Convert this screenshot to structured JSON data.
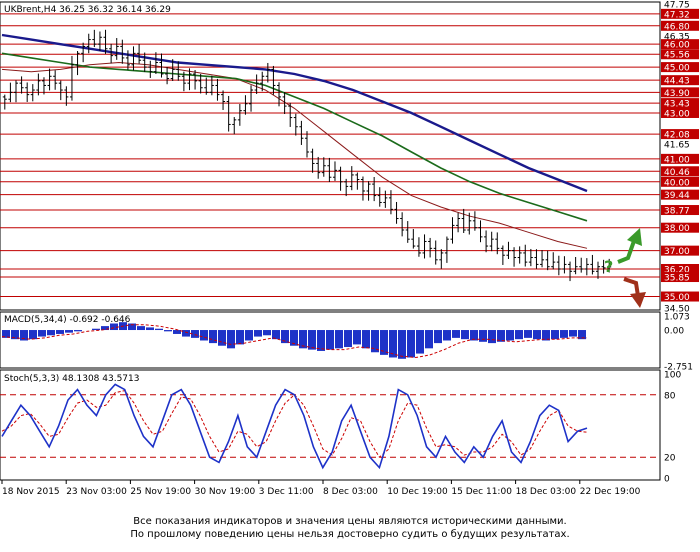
{
  "header": {
    "main": "UKBrent,H4  36.25 36.32 36.14 36.29",
    "macd": "MACD(5,34,4) -0.692 -0.646",
    "stoch": "Stoch(5,3,3) 48.1308 43.5713"
  },
  "disclaimer": {
    "line1": "Все показания индикаторов и значения цены являются историческими данными.",
    "line2": "По прошлому поведению цены нельзя достоверно судить о будущих результатах."
  },
  "colors": {
    "level_line": "#c00000",
    "price_tag_bg": "#c00000",
    "bars": "#000000",
    "ma_slow": "#1a1a8c",
    "ma_mid": "#1b6b1b",
    "ma_fast": "#8b1a1a",
    "macd_hist": "#1e32c8",
    "macd_signal": "#cc0000",
    "stoch_main": "#1e32c8",
    "stoch_signal": "#cc0000",
    "arrow_up": "#3a9a2a",
    "arrow_down": "#a0301a"
  },
  "icons": {
    "arrow_up": "green-up-arrow-icon",
    "arrow_down": "brown-down-arrow-icon",
    "question": "question-mark-icon"
  },
  "question_mark": "?",
  "chart_data": {
    "type": "candlestick",
    "timeframe": "H4",
    "symbol": "UKBrent",
    "ylim": [
      34.5,
      47.75
    ],
    "price_axis_ticks": [
      "47.75",
      "47.32",
      "46.80",
      "46.35",
      "46.00",
      "45.56",
      "45.00",
      "44.43",
      "43.90",
      "43.43",
      "43.00",
      "42.08",
      "41.65",
      "41.00",
      "40.46",
      "40.00",
      "39.44",
      "38.77",
      "38.00",
      "37.00",
      "36.20",
      "35.85",
      "35.00",
      "34.50"
    ],
    "highlighted_levels": [
      "47.32",
      "46.80",
      "46.00",
      "45.56",
      "45.00",
      "44.43",
      "43.90",
      "43.43",
      "43.00",
      "42.08",
      "41.00",
      "40.46",
      "40.00",
      "39.44",
      "38.77",
      "38.00",
      "37.00",
      "36.20",
      "35.85",
      "35.00"
    ],
    "x_tick_labels": [
      "18 Nov 2015",
      "23 Nov 03:00",
      "25 Nov 19:00",
      "30 Nov 19:00",
      "3 Dec 11:00",
      "8 Dec 03:00",
      "10 Dec 19:00",
      "15 Dec 11:00",
      "18 Dec 03:00",
      "22 Dec 19:00"
    ],
    "close_series": [
      43.6,
      43.9,
      44.3,
      44.1,
      43.8,
      44.0,
      44.4,
      44.2,
      44.6,
      44.3,
      44.0,
      43.7,
      45.1,
      45.6,
      45.9,
      46.2,
      46.0,
      46.3,
      45.8,
      45.5,
      45.9,
      45.4,
      45.1,
      45.6,
      45.3,
      45.0,
      44.8,
      45.2,
      44.7,
      44.5,
      44.9,
      44.6,
      44.3,
      44.7,
      44.4,
      44.1,
      43.9,
      44.2,
      43.8,
      43.5,
      42.5,
      42.7,
      43.1,
      43.4,
      44.0,
      44.3,
      44.6,
      44.9,
      44.2,
      43.7,
      43.3,
      42.8,
      42.4,
      41.9,
      41.3,
      40.8,
      40.4,
      40.7,
      40.2,
      40.5,
      40.0,
      39.8,
      40.3,
      40.1,
      39.6,
      39.9,
      39.4,
      39.1,
      39.3,
      38.8,
      38.4,
      37.9,
      37.5,
      37.2,
      36.9,
      37.4,
      37.1,
      36.6,
      36.9,
      37.5,
      38.1,
      38.4,
      37.9,
      38.3,
      38.0,
      37.6,
      37.2,
      37.5,
      37.1,
      36.8,
      37.0,
      36.7,
      36.9,
      36.5,
      36.7,
      36.4,
      36.6,
      36.3,
      36.5,
      36.2,
      36.4,
      36.1,
      36.3,
      36.2,
      36.4,
      36.1,
      36.3,
      36.25,
      36.29
    ],
    "ma_slow": [
      46.4,
      46.2,
      46.0,
      45.8,
      45.6,
      45.4,
      45.2,
      45.1,
      45.0,
      44.9,
      44.7,
      44.4,
      44.0,
      43.5,
      43.0,
      42.4,
      41.8,
      41.2,
      40.6,
      40.1,
      39.6
    ],
    "ma_mid": [
      45.6,
      45.4,
      45.2,
      45.0,
      44.9,
      44.8,
      44.7,
      44.6,
      44.5,
      44.2,
      43.7,
      43.2,
      42.6,
      42.0,
      41.3,
      40.6,
      40.0,
      39.5,
      39.1,
      38.7,
      38.3
    ],
    "ma_fast": [
      44.9,
      44.8,
      44.9,
      45.1,
      45.2,
      45.1,
      44.9,
      44.7,
      44.5,
      44.0,
      43.2,
      42.2,
      41.2,
      40.2,
      39.4,
      38.9,
      38.5,
      38.2,
      37.8,
      37.4,
      37.1
    ],
    "macd": {
      "ylim": [
        -2.751,
        1.073
      ],
      "ticks": [
        "1.073",
        "0.00",
        "-2.751"
      ],
      "histogram": [
        -0.6,
        -0.7,
        -0.8,
        -0.7,
        -0.5,
        -0.4,
        -0.3,
        -0.2,
        -0.1,
        0.0,
        0.1,
        0.3,
        0.5,
        0.6,
        0.5,
        0.3,
        0.2,
        0.1,
        -0.1,
        -0.3,
        -0.5,
        -0.6,
        -0.8,
        -1.0,
        -1.2,
        -1.4,
        -1.1,
        -0.8,
        -0.5,
        -0.4,
        -0.7,
        -1.0,
        -1.2,
        -1.4,
        -1.5,
        -1.6,
        -1.5,
        -1.4,
        -1.3,
        -1.1,
        -1.4,
        -1.7,
        -1.9,
        -2.1,
        -2.2,
        -2.1,
        -1.8,
        -1.4,
        -1.0,
        -0.8,
        -0.6,
        -0.7,
        -0.8,
        -0.9,
        -1.0,
        -0.9,
        -0.8,
        -0.7,
        -0.6,
        -0.7,
        -0.8,
        -0.7,
        -0.6,
        -0.5,
        -0.7
      ],
      "signal": [
        -0.5,
        -0.6,
        -0.7,
        -0.6,
        -0.4,
        -0.3,
        -0.1,
        0.0,
        0.2,
        0.4,
        0.4,
        0.3,
        0.1,
        -0.2,
        -0.5,
        -0.8,
        -1.1,
        -1.0,
        -0.8,
        -0.6,
        -0.9,
        -1.2,
        -1.4,
        -1.5,
        -1.5,
        -1.3,
        -1.4,
        -1.7,
        -2.0,
        -2.1,
        -1.9,
        -1.5,
        -1.0,
        -0.7,
        -0.7,
        -0.8,
        -0.9,
        -0.8,
        -0.7,
        -0.7,
        -0.6,
        -0.6
      ]
    },
    "stochastic": {
      "ylim": [
        0,
        100
      ],
      "ticks": [
        "100",
        "80",
        "20",
        "0"
      ],
      "levels": [
        80,
        20
      ],
      "main": [
        40,
        55,
        70,
        60,
        45,
        30,
        50,
        75,
        85,
        70,
        60,
        80,
        90,
        85,
        60,
        40,
        30,
        55,
        80,
        85,
        70,
        45,
        20,
        15,
        35,
        60,
        30,
        20,
        45,
        70,
        85,
        80,
        60,
        30,
        10,
        25,
        55,
        70,
        45,
        20,
        10,
        40,
        85,
        80,
        60,
        30,
        20,
        40,
        25,
        15,
        30,
        20,
        40,
        55,
        25,
        15,
        35,
        60,
        70,
        65,
        35,
        45,
        48
      ],
      "signal": [
        45,
        50,
        60,
        62,
        52,
        40,
        42,
        58,
        72,
        75,
        68,
        70,
        82,
        84,
        72,
        55,
        42,
        45,
        62,
        78,
        76,
        60,
        40,
        25,
        28,
        45,
        42,
        30,
        35,
        55,
        72,
        80,
        70,
        50,
        28,
        22,
        38,
        58,
        55,
        35,
        20,
        28,
        55,
        72,
        70,
        48,
        30,
        32,
        30,
        22,
        25,
        25,
        30,
        42,
        35,
        22,
        28,
        45,
        60,
        65,
        50,
        45,
        44
      ]
    }
  }
}
